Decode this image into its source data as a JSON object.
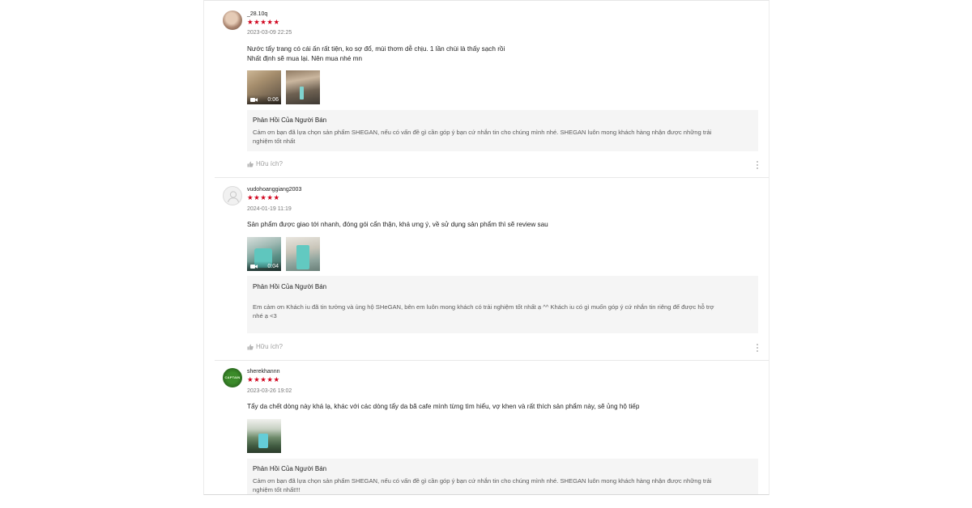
{
  "reviews": [
    {
      "username": "_28.10q",
      "stars": "★★★★★",
      "date": "2023-03-09 22:25",
      "content": [
        "Nước tẩy trang có cái ấn rất tiện, ko sợ đổ, mùi thơm dễ chịu. 1 lần chùi là thấy sạch rồi",
        "Nhất định sẽ mua lại. Nên mua nhé mn"
      ],
      "media": [
        {
          "type": "video",
          "duration": "0:06"
        },
        {
          "type": "image"
        }
      ],
      "reply_title": "Phản Hồi Của Người Bán",
      "reply_text": [
        "Cảm ơn bạn đã lựa chọn sản phẩm SHEGAN, nếu có vấn đề gì cần góp ý bạn cứ nhắn tin cho chúng mình nhé. SHEGAN luôn mong khách hàng nhận được những trải",
        "nghiệm tốt nhất"
      ],
      "helpful_label": "Hữu ích?"
    },
    {
      "username": "vudohoanggiang2003",
      "stars": "★★★★★",
      "date": "2024-01-19 11:19",
      "content": [
        "Sản phẩm được giao tới nhanh, đóng gói cẩn thận, khá ưng ý, về sử dụng sản phẩm thì sẽ review sau"
      ],
      "media": [
        {
          "type": "video",
          "duration": "0:04"
        },
        {
          "type": "image"
        }
      ],
      "reply_title": "Phản Hồi Của Người Bán",
      "reply_text": [
        "Em cảm ơn Khách iu đã tin tưởng và ủng hộ SHeGAN, bên em luôn mong khách có trải nghiệm tốt nhất ạ ^^ Khách iu có gì muốn góp ý cứ nhắn tin riêng để được hỗ trợ",
        "nhé ạ <3"
      ],
      "helpful_label": "Hữu ích?"
    },
    {
      "username": "sherekhannn",
      "avatar_text": "CAPTAIN",
      "stars": "★★★★★",
      "date": "2023-03-26 19:02",
      "content": [
        "Tẩy da chết dòng này khá lạ, khác với các dòng tẩy da bã cafe mình từng tìm hiểu, vợ khen và rất thích sản phẩm này, sẽ ủng hộ tiếp"
      ],
      "media": [
        {
          "type": "image"
        }
      ],
      "reply_title": "Phản Hồi Của Người Bán",
      "reply_text": [
        "Cảm ơn bạn đã lựa chọn sản phẩm SHEGAN, nếu có vấn đề gì cần góp ý bạn cứ nhắn tin cho chúng mình nhé. SHEGAN luôn mong khách hàng nhận được những trải",
        "nghiệm tốt nhất!!!"
      ]
    }
  ],
  "colors": {
    "star": "#d0011b",
    "reply_bg": "#f5f5f5",
    "muted_text": "#8a8a8a"
  },
  "icons": [
    "video-camera-icon",
    "thumbs-up-icon",
    "more-options-icon",
    "default-user-icon"
  ]
}
